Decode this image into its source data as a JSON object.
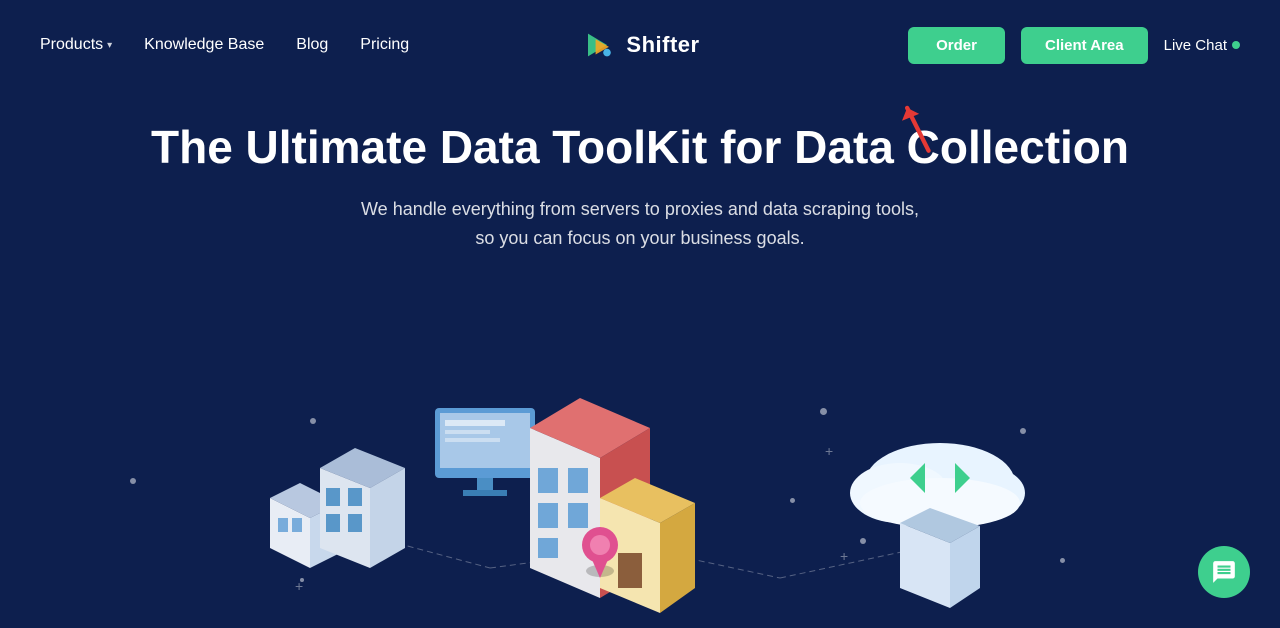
{
  "nav": {
    "products_label": "Products",
    "knowledge_base_label": "Knowledge Base",
    "blog_label": "Blog",
    "pricing_label": "Pricing",
    "logo_text": "Shifter",
    "order_label": "Order",
    "client_area_label": "Client Area",
    "live_chat_label": "Live Chat"
  },
  "hero": {
    "title": "The Ultimate Data ToolKit for Data Collection",
    "subtitle_line1": "We handle everything from servers to proxies and data scraping tools,",
    "subtitle_line2": "so you can focus on your business goals."
  },
  "chat_widget": {
    "label": "chat"
  }
}
